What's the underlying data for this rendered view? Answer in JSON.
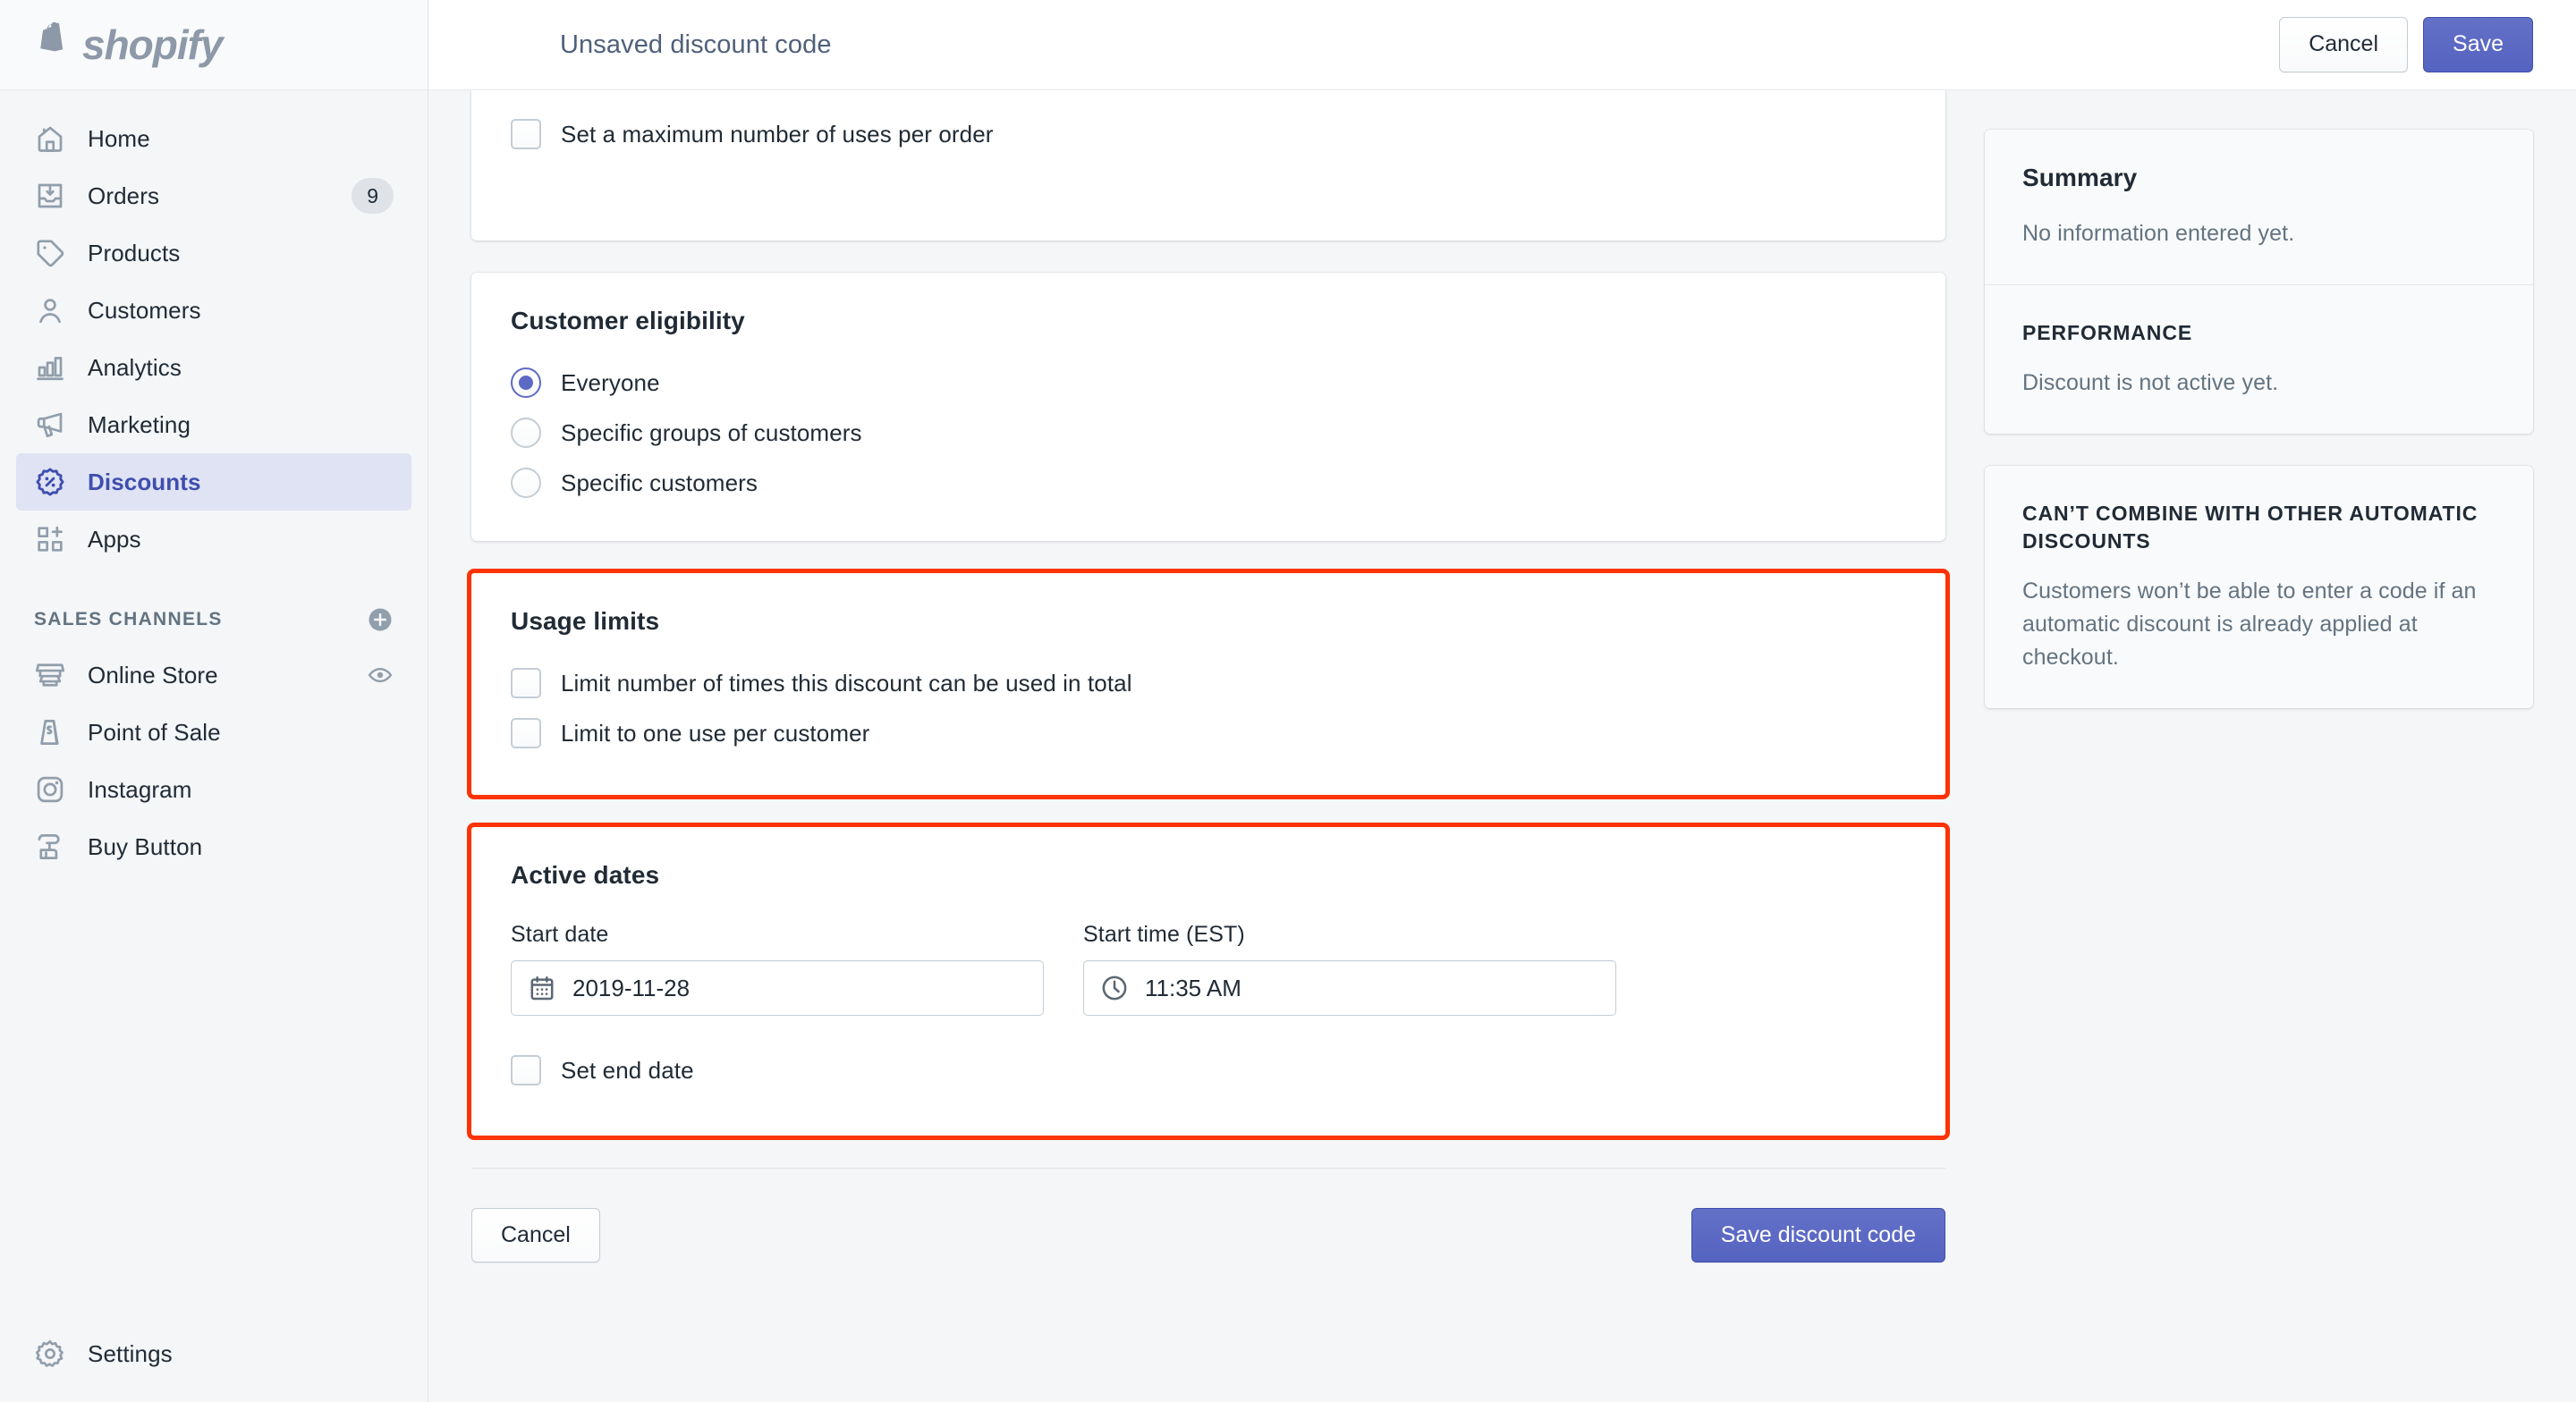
{
  "brand": {
    "name": "shopify",
    "logo_icon": "shopify-bag-icon",
    "accent_color": "#5c6ac4",
    "highlight_color": "#fc3305"
  },
  "sidebar": {
    "items": [
      {
        "label": "Home",
        "icon": "home-icon",
        "badge": "",
        "active": false
      },
      {
        "label": "Orders",
        "icon": "orders-inbox-icon",
        "badge": "9",
        "active": false
      },
      {
        "label": "Products",
        "icon": "product-tag-icon",
        "badge": "",
        "active": false
      },
      {
        "label": "Customers",
        "icon": "customer-person-icon",
        "badge": "",
        "active": false
      },
      {
        "label": "Analytics",
        "icon": "analytics-bar-chart-icon",
        "badge": "",
        "active": false
      },
      {
        "label": "Marketing",
        "icon": "marketing-megaphone-icon",
        "badge": "",
        "active": false
      },
      {
        "label": "Discounts",
        "icon": "discount-percent-badge-icon",
        "badge": "",
        "active": true
      },
      {
        "label": "Apps",
        "icon": "apps-grid-plus-icon",
        "badge": "",
        "active": false
      }
    ],
    "sales_channels": {
      "title": "SALES CHANNELS",
      "add_icon": "plus-circle-icon",
      "items": [
        {
          "label": "Online Store",
          "icon": "online-store-icon",
          "trailing_icon": "eye-icon"
        },
        {
          "label": "Point of Sale",
          "icon": "point-of-sale-icon",
          "trailing_icon": ""
        },
        {
          "label": "Instagram",
          "icon": "instagram-icon",
          "trailing_icon": ""
        },
        {
          "label": "Buy Button",
          "icon": "buy-button-icon",
          "trailing_icon": ""
        }
      ]
    },
    "settings": {
      "label": "Settings",
      "icon": "gear-icon"
    }
  },
  "topbar": {
    "title": "Unsaved discount code",
    "cancel_label": "Cancel",
    "save_label": "Save"
  },
  "main": {
    "max_uses_card": {
      "checkbox_label": "Set a maximum number of uses per order",
      "checked": false
    },
    "customer_eligibility": {
      "title": "Customer eligibility",
      "options": [
        {
          "label": "Everyone",
          "selected": true
        },
        {
          "label": "Specific groups of customers",
          "selected": false
        },
        {
          "label": "Specific customers",
          "selected": false
        }
      ]
    },
    "usage_limits": {
      "title": "Usage limits",
      "highlighted": true,
      "options": [
        {
          "label": "Limit number of times this discount can be used in total",
          "checked": false
        },
        {
          "label": "Limit to one use per customer",
          "checked": false
        }
      ]
    },
    "active_dates": {
      "title": "Active dates",
      "highlighted": true,
      "start_date": {
        "label": "Start date",
        "value": "2019-11-28",
        "icon": "calendar-icon"
      },
      "start_time": {
        "label": "Start time (EST)",
        "value": "11:35 AM",
        "icon": "clock-icon"
      },
      "end_date_checkbox": {
        "label": "Set end date",
        "checked": false
      }
    },
    "footer": {
      "cancel_label": "Cancel",
      "save_label": "Save discount code"
    }
  },
  "side": {
    "summary": {
      "title": "Summary",
      "text": "No information entered yet.",
      "performance_title": "PERFORMANCE",
      "performance_text": "Discount is not active yet."
    },
    "combine": {
      "title": "CAN’T COMBINE WITH OTHER AUTOMATIC DISCOUNTS",
      "text": "Customers won’t be able to enter a code if an automatic discount is already applied at checkout."
    }
  }
}
